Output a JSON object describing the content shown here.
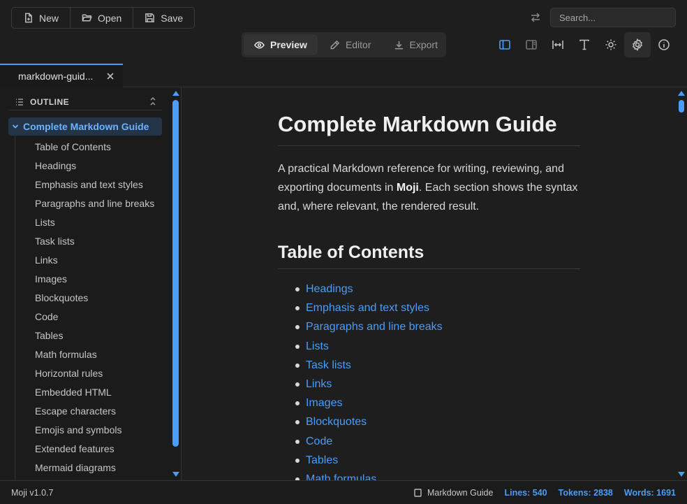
{
  "toolbar": {
    "new_label": "New",
    "open_label": "Open",
    "save_label": "Save"
  },
  "search": {
    "placeholder": "Search..."
  },
  "modes": {
    "preview_label": "Preview",
    "editor_label": "Editor",
    "export_label": "Export",
    "active": "Preview"
  },
  "tools": [
    "sidebar-toggle-icon",
    "split-view-icon",
    "width-icon",
    "font-icon",
    "theme-sun-icon",
    "gear-icon",
    "info-icon"
  ],
  "tab": {
    "label": "markdown-guid..."
  },
  "outline": {
    "heading": "OUTLINE",
    "root": "Complete Markdown Guide",
    "items": [
      "Table of Contents",
      "Headings",
      "Emphasis and text styles",
      "Paragraphs and line breaks",
      "Lists",
      "Task lists",
      "Links",
      "Images",
      "Blockquotes",
      "Code",
      "Tables",
      "Math formulas",
      "Horizontal rules",
      "Embedded HTML",
      "Escape characters",
      "Emojis and symbols",
      "Extended features",
      "Mermaid diagrams"
    ]
  },
  "document": {
    "title": "Complete Markdown Guide",
    "intro_before": "A practical Markdown reference for writing, reviewing, and exporting documents in ",
    "intro_bold": "Moji",
    "intro_after": ". Each section shows the syntax and, where relevant, the rendered result.",
    "toc_heading": "Table of Contents",
    "toc": [
      "Headings",
      "Emphasis and text styles",
      "Paragraphs and line breaks",
      "Lists",
      "Task lists",
      "Links",
      "Images",
      "Blockquotes",
      "Code",
      "Tables",
      "Math formulas"
    ]
  },
  "status": {
    "version": "Moji v1.0.7",
    "doc_name": "Markdown Guide",
    "lines": "Lines: 540",
    "tokens": "Tokens: 2838",
    "words": "Words: 1691"
  },
  "colors": {
    "accent": "#4a9df8",
    "background": "#1e1e1e",
    "sidebar_bg": "#1b1b1b"
  }
}
